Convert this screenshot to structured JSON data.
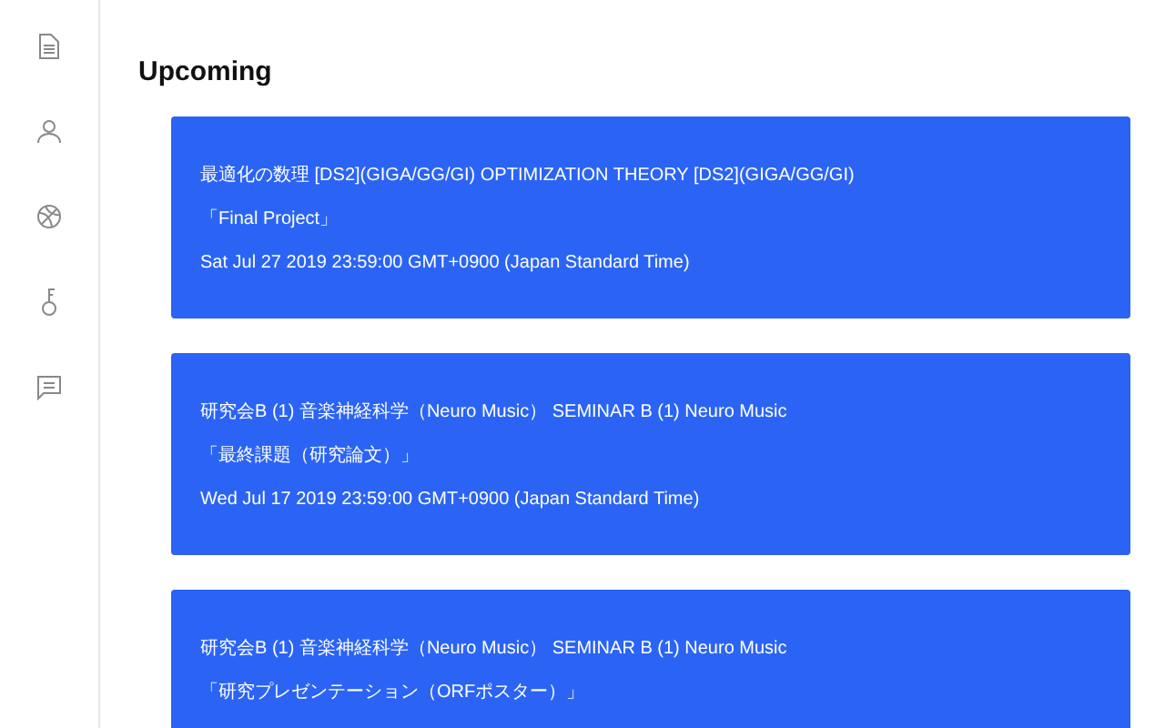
{
  "sidebar": {
    "items": [
      {
        "kind": "document"
      },
      {
        "kind": "person"
      },
      {
        "kind": "ball"
      },
      {
        "kind": "key"
      },
      {
        "kind": "chat"
      }
    ]
  },
  "heading": "Upcoming",
  "cards": [
    {
      "course": "最適化の数理 [DS2](GIGA/GG/GI) OPTIMIZATION THEORY [DS2](GIGA/GG/GI)",
      "assignment": "「Final Project」",
      "due": "Sat Jul 27 2019 23:59:00 GMT+0900 (Japan Standard Time)"
    },
    {
      "course": "研究会B (1) 音楽神経科学（Neuro Music）  SEMINAR B (1) Neuro Music",
      "assignment": "「最終課題（研究論文）」",
      "due": "Wed Jul 17 2019 23:59:00 GMT+0900 (Japan Standard Time)"
    },
    {
      "course": "研究会B (1) 音楽神経科学（Neuro Music）  SEMINAR B (1) Neuro Music",
      "assignment": "「研究プレゼンテーション（ORFポスター）」"
    }
  ]
}
